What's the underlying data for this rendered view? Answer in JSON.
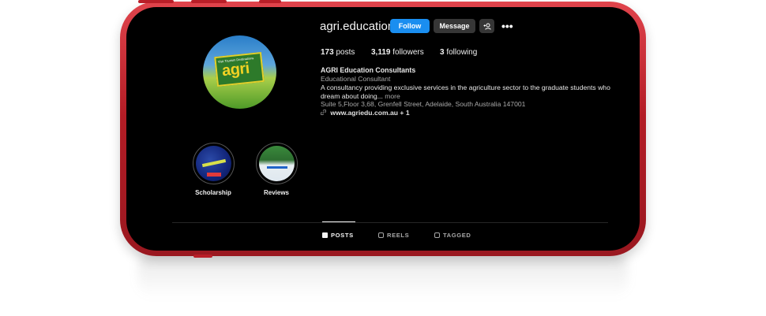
{
  "profile": {
    "username": "agri.education",
    "follow_label": "Follow",
    "message_label": "Message",
    "more_icon": "•••",
    "logo_small_text": "Visit Tourism Destinations",
    "logo_word": "agri",
    "posts_count": "173",
    "posts_label": "posts",
    "followers_count": "3,119",
    "followers_label": "followers",
    "following_count": "3",
    "following_label": "following",
    "display_name": "AGRI Education Consultants",
    "category": "Educational Consultant",
    "bio": "A consultancy providing exclusive services in the agriculture sector to the graduate students who dream about doing...",
    "bio_more": "more",
    "address": "Suite 5,Floor 3,68, Grenfell Street, Adelaide, South Australia 147001",
    "link_icon": "🔗",
    "link": "www.agriedu.com.au",
    "link_extra": "+ 1"
  },
  "highlights": [
    {
      "label": "Scholarship"
    },
    {
      "label": "Reviews"
    }
  ],
  "tabs": [
    {
      "label": "POSTS",
      "active": true
    },
    {
      "label": "REELS",
      "active": false
    },
    {
      "label": "TAGGED",
      "active": false
    }
  ],
  "colors": {
    "phone_frame": "#b31c25",
    "follow_button": "#1a8ef0",
    "secondary_button": "#363636",
    "screen_background": "#000000"
  }
}
